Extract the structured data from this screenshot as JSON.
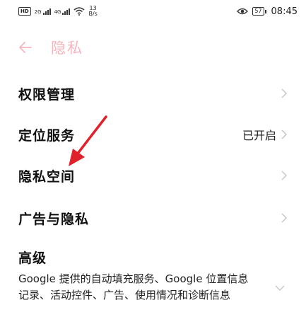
{
  "status_bar": {
    "hd": "HD",
    "sim1": "2G",
    "sim2": "4G",
    "speed_value": "13",
    "speed_unit": "B/s",
    "eye_icon": "eye-icon",
    "battery": "57",
    "time": "08:45"
  },
  "header": {
    "title": "隐私",
    "back_icon": "arrow-left-icon"
  },
  "menu": {
    "items": [
      {
        "label": "权限管理",
        "value": ""
      },
      {
        "label": "定位服务",
        "value": "已开启"
      },
      {
        "label": "隐私空间",
        "value": ""
      },
      {
        "label": "广告与隐私",
        "value": ""
      }
    ]
  },
  "advanced": {
    "title": "高级",
    "description": "Google 提供的自动填充服务、Google 位置信息记录、活动控件、广告、使用情况和诊断信息"
  },
  "colors": {
    "accent": "#f3b6bd",
    "arrow_annotation": "#e0202a",
    "chevron": "#c8c8c8"
  }
}
